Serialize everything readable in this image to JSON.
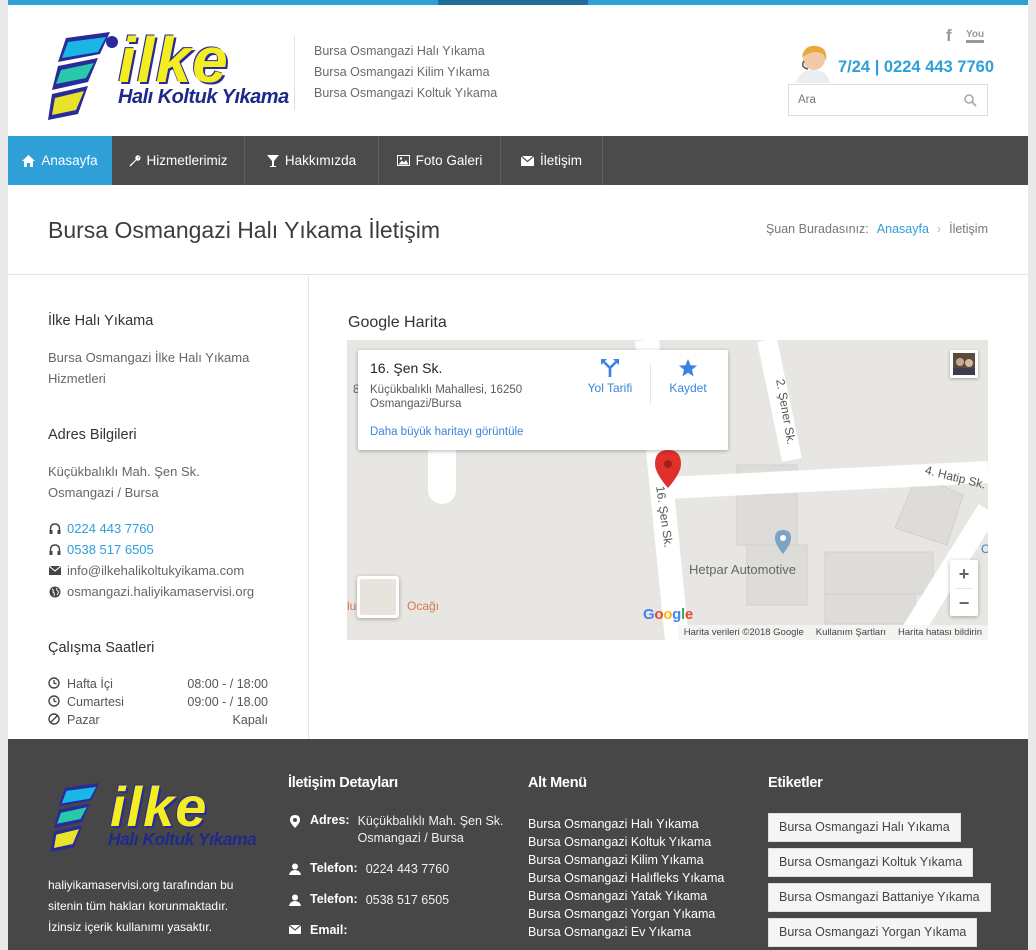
{
  "brand": {
    "name": "ilke",
    "subtitle": "Halı Koltuk Yıkama",
    "colors": {
      "accent": "#2f9fd8",
      "nav": "#4b4b4b",
      "footer": "#474747"
    }
  },
  "header": {
    "taglines": [
      "Bursa Osmangazi Halı Yıkama",
      "Bursa Osmangazi Kilim Yıkama",
      "Bursa Osmangazi Koltuk Yıkama"
    ],
    "social": {
      "facebook_icon": "f",
      "youtube_icon": "You"
    },
    "phone": "7/24 | 0224 443 7760",
    "search_placeholder": "Ara"
  },
  "nav": {
    "items": [
      {
        "label": "Anasayfa",
        "icon": "home-icon"
      },
      {
        "label": "Hizmetlerimiz",
        "icon": "wrench-icon"
      },
      {
        "label": "Hakkımızda",
        "icon": "glass-icon"
      },
      {
        "label": "Foto Galeri",
        "icon": "picture-icon"
      },
      {
        "label": "İletişim",
        "icon": "envelope-icon"
      }
    ]
  },
  "titlebar": {
    "title": "Bursa Osmangazi Halı Yıkama İletişim",
    "breadcrumb_prefix": "Şuan Buradasınız:",
    "breadcrumb_home": "Anasayfa",
    "breadcrumb_sep": "›",
    "breadcrumb_current": "İletişim"
  },
  "sidebar": {
    "company_heading": "İlke Halı Yıkama",
    "company_text_1": "Bursa Osmangazi İlke Halı Yıkama",
    "company_text_2": "Hizmetleri",
    "address_heading": "Adres Bilgileri",
    "address_line_1": "Küçükbalıklı Mah. Şen Sk.",
    "address_line_2": "Osmangazi / Bursa",
    "phone_1": "0224 443 7760",
    "phone_2": "0538 517 6505",
    "email": "info@ilkehalikoltukyikama.com",
    "website": "osmangazi.haliyikamaservisi.org",
    "hours_heading": "Çalışma Saatleri",
    "hours": [
      {
        "day": "Hafta İçi",
        "time": "08:00 - / 18:00"
      },
      {
        "day": "Cumartesi",
        "time": "09:00 - / 18.00"
      },
      {
        "day": "Pazar",
        "time": "Kapalı"
      }
    ]
  },
  "map": {
    "section_title": "Google Harita",
    "place_title": "16. Şen Sk.",
    "place_address_1": "Küçükbalıklı Mahallesi, 16250",
    "place_address_2": "Osmangazi/Bursa",
    "directions_label": "Yol Tarifi",
    "save_label": "Kaydet",
    "larger_map_link": "Daha büyük haritayı görüntüle",
    "streets": {
      "s1": "2. Şener Sk.",
      "s2": "4. Hatip Sk.",
      "s3": "16. Şen Sk."
    },
    "poi": "Hetpar Automotive",
    "poi2": "Ocağı",
    "poi2_prefix": "lu",
    "edge_label_1": "8",
    "edge_label_2": "C",
    "zoom_in": "+",
    "zoom_out": "−",
    "footer_data": "Harita verileri ©2018 Google",
    "footer_terms": "Kullanım Şartları",
    "footer_report": "Harita hatası bildirin",
    "google_logo": "Google"
  },
  "footer": {
    "copyright_1": "haliyikamaservisi.org tarafından bu",
    "copyright_2": "sitenin tüm hakları korunmaktadır.",
    "copyright_3": "İzinsiz içerik kullanımı yasaktır.",
    "contact_heading": "İletişim Detayları",
    "address_label": "Adres:",
    "address_value_1": "Küçükbalıklı Mah. Şen Sk.",
    "address_value_2": "Osmangazi / Bursa",
    "phone_label": "Telefon:",
    "phone_value_1": "0224 443 7760",
    "phone_value_2": "0538 517 6505",
    "email_label": "Email:",
    "menu_heading": "Alt Menü",
    "menu_items": [
      "Bursa Osmangazi Halı Yıkama",
      "Bursa Osmangazi Koltuk Yıkama",
      "Bursa Osmangazi Kilim Yıkama",
      "Bursa Osmangazi Halıfleks Yıkama",
      "Bursa Osmangazi Yatak Yıkama",
      "Bursa Osmangazi Yorgan Yıkama",
      "Bursa Osmangazi Ev Yıkama"
    ],
    "tags_heading": "Etiketler",
    "tags": [
      "Bursa Osmangazi Halı Yıkama",
      "Bursa Osmangazi Koltuk Yıkama",
      "Bursa Osmangazi Battaniye Yıkama",
      "Bursa Osmangazi Yorgan Yıkama"
    ]
  }
}
